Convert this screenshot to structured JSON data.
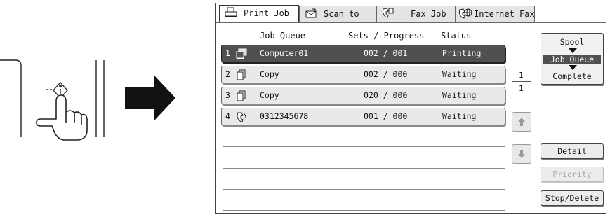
{
  "tabs": [
    {
      "label": "Print Job",
      "icon": "printer-icon",
      "active": true
    },
    {
      "label": "Scan to",
      "icon": "scanner-icon",
      "active": false
    },
    {
      "label": "Fax Job",
      "icon": "fax-icon",
      "active": false
    },
    {
      "label": "Internet Fax",
      "icon": "internet-fax-icon",
      "active": false
    }
  ],
  "columns": {
    "queue": "Job Queue",
    "sets": "Sets / Progress",
    "status": "Status"
  },
  "jobs": [
    {
      "num": "1",
      "icon": "computer-icon",
      "name": "Computer01",
      "sets": "002 / 001",
      "status": "Printing",
      "selected": true
    },
    {
      "num": "2",
      "icon": "copy-icon",
      "name": "Copy",
      "sets": "002 / 000",
      "status": "Waiting",
      "selected": false
    },
    {
      "num": "3",
      "icon": "copy-icon",
      "name": "Copy",
      "sets": "020 / 000",
      "status": "Waiting",
      "selected": false
    },
    {
      "num": "4",
      "icon": "fax-phone-icon",
      "name": "0312345678",
      "sets": "001 / 000",
      "status": "Waiting",
      "selected": false
    }
  ],
  "pager": {
    "current": "1",
    "total": "1"
  },
  "spool": {
    "spool": "Spool",
    "queue": "Job Queue",
    "complete": "Complete"
  },
  "buttons": {
    "detail": "Detail",
    "priority": "Priority",
    "stop_delete": "Stop/Delete"
  },
  "colors": {
    "selected_row": "#505050",
    "row": "#e9e9e9"
  }
}
